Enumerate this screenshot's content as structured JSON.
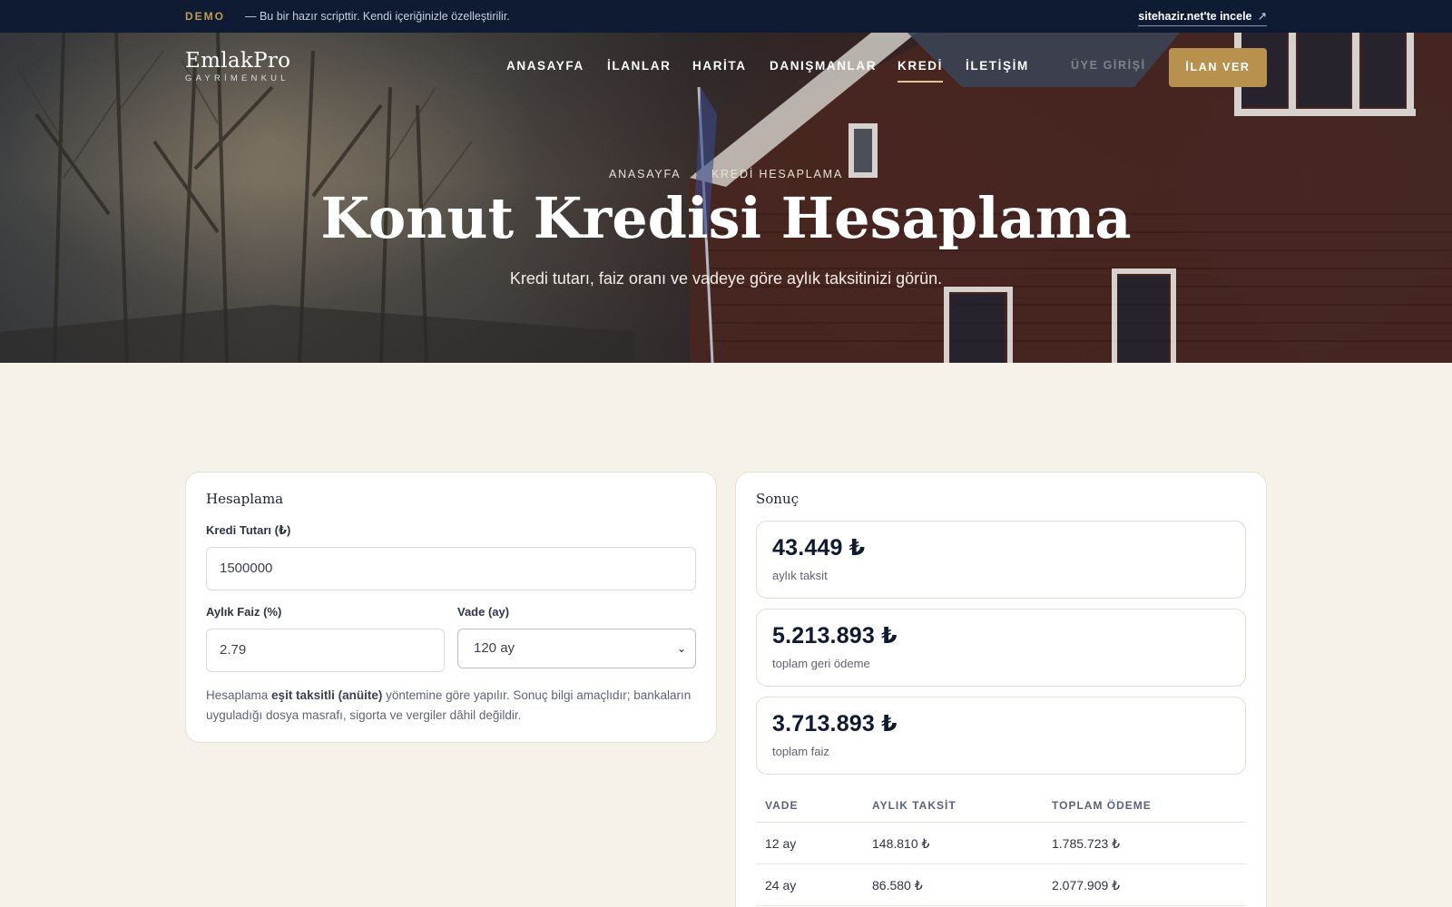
{
  "demo": {
    "tag": "DEMO",
    "text": "— Bu bir hazır scripttir. Kendi içeriğinizle özelleştirilir.",
    "link": "sitehazir.net'te incele",
    "link_icon": "external-arrow-icon"
  },
  "brand": {
    "name": "EmlakPro",
    "tagline": "GAYRİMENKUL"
  },
  "nav": {
    "items": [
      {
        "label": "ANASAYFA"
      },
      {
        "label": "İLANLAR"
      },
      {
        "label": "HARİTA"
      },
      {
        "label": "DANIŞMANLAR"
      },
      {
        "label": "KREDİ",
        "active": true
      },
      {
        "label": "İLETİŞİM"
      }
    ],
    "login": "ÜYE GİRİŞİ",
    "cta": "İLAN VER"
  },
  "hero": {
    "breadcrumb": [
      "ANASAYFA",
      "KREDİ HESAPLAMA"
    ],
    "title": "Konut Kredisi Hesaplama",
    "subtitle": "Kredi tutarı, faiz oranı ve vadeye göre aylık taksitinizi görün."
  },
  "form": {
    "title": "Hesaplama",
    "amount_label": "Kredi Tutarı (₺)",
    "amount_value": "1500000",
    "rate_label": "Aylık Faiz (%)",
    "rate_value": "2.79",
    "term_label": "Vade (ay)",
    "term_value": "120 ay",
    "note_pre": "Hesaplama ",
    "note_bold": "eşit taksitli (anüite)",
    "note_post": " yöntemine göre yapılır. Sonuç bilgi amaçlıdır; bankaların uyguladığı dosya masrafı, sigorta ve vergiler dâhil değildir."
  },
  "result": {
    "title": "Sonuç",
    "boxes": [
      {
        "value": "43.449 ₺",
        "label": "aylık taksit"
      },
      {
        "value": "5.213.893 ₺",
        "label": "toplam geri ödeme"
      },
      {
        "value": "3.713.893 ₺",
        "label": "toplam faiz"
      }
    ],
    "table": {
      "headers": [
        "VADE",
        "AYLIK TAKSİT",
        "TOPLAM ÖDEME"
      ],
      "rows": [
        [
          "12 ay",
          "148.810 ₺",
          "1.785.723 ₺"
        ],
        [
          "24 ay",
          "86.580 ₺",
          "2.077.909 ₺"
        ]
      ]
    }
  }
}
